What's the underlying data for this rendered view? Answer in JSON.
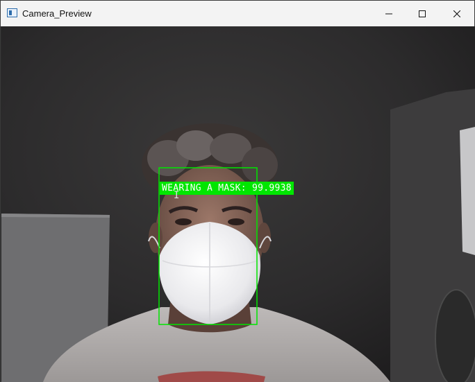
{
  "window": {
    "title": "Camera_Preview",
    "controls": {
      "minimize": "minimize-icon",
      "maximize": "maximize-icon",
      "close": "close-icon"
    }
  },
  "detection": {
    "label": "WEARING A MASK: 99.9938",
    "box_color": "#00e600",
    "label_bg": "#00e600",
    "label_fg": "#ffffff"
  }
}
